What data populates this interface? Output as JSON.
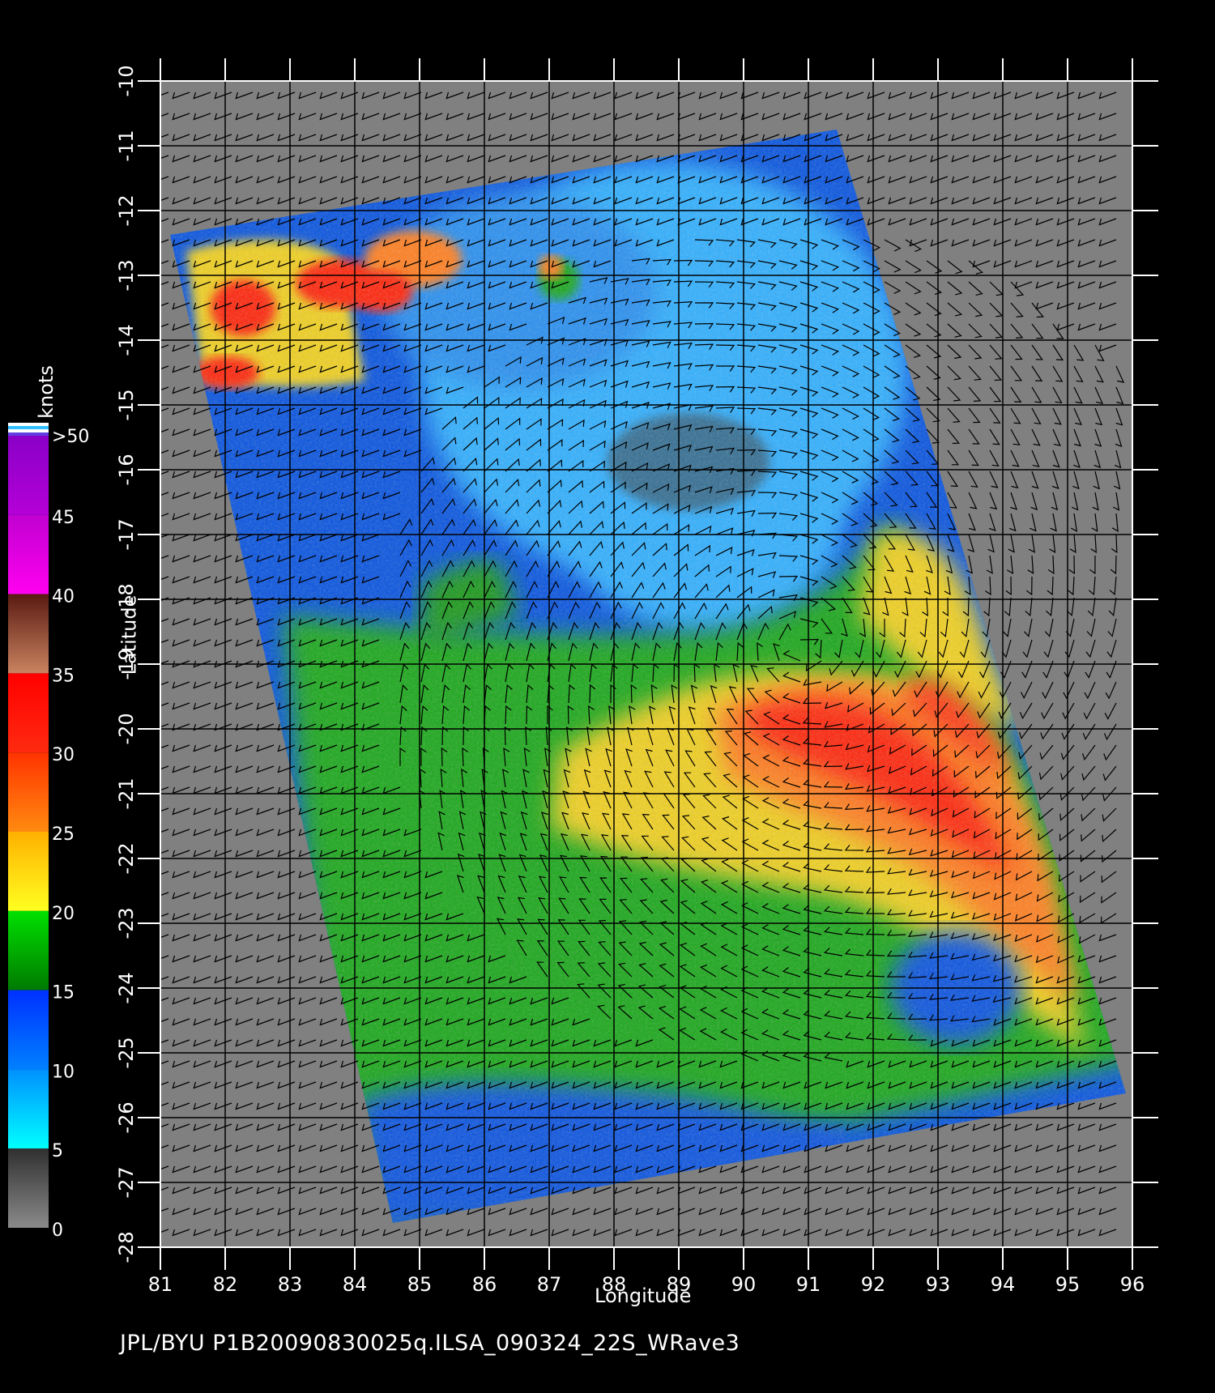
{
  "footer": {
    "text": "JPL/BYU  P1B20090830025q.ILSA_090324_22S_WRave3"
  },
  "axes": {
    "x_title": "Longitude",
    "y_title": "Latitude",
    "x_ticks": [
      "81",
      "82",
      "83",
      "84",
      "85",
      "86",
      "87",
      "88",
      "89",
      "90",
      "91",
      "92",
      "93",
      "94",
      "95",
      "96"
    ],
    "y_ticks": [
      "-10",
      "-11",
      "-12",
      "-13",
      "-14",
      "-15",
      "-16",
      "-17",
      "-18",
      "-19",
      "-20",
      "-21",
      "-22",
      "-23",
      "-24",
      "-25",
      "-26",
      "-27",
      "-28"
    ],
    "x_range": [
      81,
      96
    ],
    "y_range": [
      -10,
      -28
    ]
  },
  "colorbar": {
    "unit": "knots",
    "labels": [
      ">50",
      "45",
      "40",
      "35",
      "30",
      "25",
      "20",
      "15",
      "10",
      "5",
      "0"
    ],
    "bands": [
      {
        "from": 45,
        "to": 50,
        "top": "#8a00c8",
        "bottom": "#b400d8"
      },
      {
        "from": 40,
        "to": 45,
        "top": "#c000d0",
        "bottom": "#ff00f0"
      },
      {
        "from": 35,
        "to": 40,
        "top": "#5a1a12",
        "bottom": "#c98360"
      },
      {
        "from": 30,
        "to": 35,
        "top": "#ff0000",
        "bottom": "#ff2a10"
      },
      {
        "from": 25,
        "to": 30,
        "top": "#ff3300",
        "bottom": "#ff8a10"
      },
      {
        "from": 20,
        "to": 25,
        "top": "#ffb000",
        "bottom": "#ffff20"
      },
      {
        "from": 15,
        "to": 20,
        "top": "#00e000",
        "bottom": "#007a00"
      },
      {
        "from": 10,
        "to": 15,
        "top": "#0030ff",
        "bottom": "#0080ff"
      },
      {
        "from": 5,
        "to": 10,
        "top": "#0090ff",
        "bottom": "#00ffff"
      },
      {
        "from": 0,
        "to": 5,
        "top": "#303030",
        "bottom": "#8a8a8a"
      }
    ]
  },
  "colors": {
    "land_background": "#808080",
    "blue": "#0a55e0",
    "light_blue": "#30b0ff",
    "green": "#1ea81e",
    "yellow": "#f0d020",
    "orange": "#ff8020",
    "red": "#ff2810",
    "grid": "#000000"
  }
}
